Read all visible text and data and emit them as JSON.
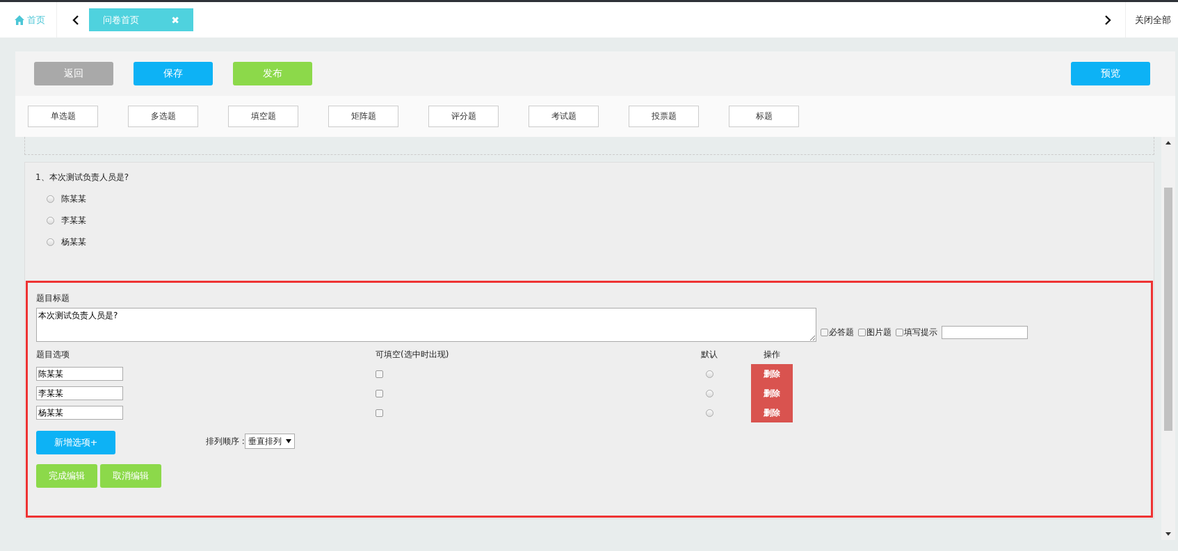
{
  "top_bar": {
    "home": "首页",
    "tabs": [
      {
        "label": "问卷首页",
        "close": "✖",
        "selected": true
      }
    ],
    "close_all": "关闭全部"
  },
  "actions": [
    {
      "label": "返回",
      "kind": "back"
    },
    {
      "label": "保存",
      "kind": "save"
    },
    {
      "label": "发布",
      "kind": "publish"
    }
  ],
  "preview": "预览",
  "question_types": [
    "单选题",
    "多选题",
    "填空题",
    "矩阵题",
    "评分题",
    "考试题",
    "投票题",
    "标题"
  ],
  "question": {
    "title": "1、本次测试负责人员是?",
    "options": [
      {
        "label": "陈某某",
        "selected": false
      },
      {
        "label": "李某某",
        "selected": false
      },
      {
        "label": "杨某某",
        "selected": false
      }
    ]
  },
  "editor": {
    "title_label": "题目标题",
    "title_value": "本次测试负责人员是?",
    "flags": [
      {
        "label": "必答题",
        "checked": false
      },
      {
        "label": "图片题",
        "checked": false
      },
      {
        "label": "填写提示",
        "checked": false
      }
    ],
    "columns": [
      "题目选项",
      "可填空(选中时出现)",
      "默认",
      "操作"
    ],
    "rows": [
      {
        "value": "陈某某",
        "fillable": false,
        "default": false,
        "action": "删除"
      },
      {
        "value": "李某某",
        "fillable": false,
        "default": false,
        "action": "删除"
      },
      {
        "value": "杨某某",
        "fillable": false,
        "default": false,
        "action": "删除"
      }
    ],
    "add_option": "新增选项+",
    "order_label": "排列顺序 :",
    "order_value": "垂直排列",
    "finish": "完成编辑",
    "cancel": "取消编辑"
  }
}
